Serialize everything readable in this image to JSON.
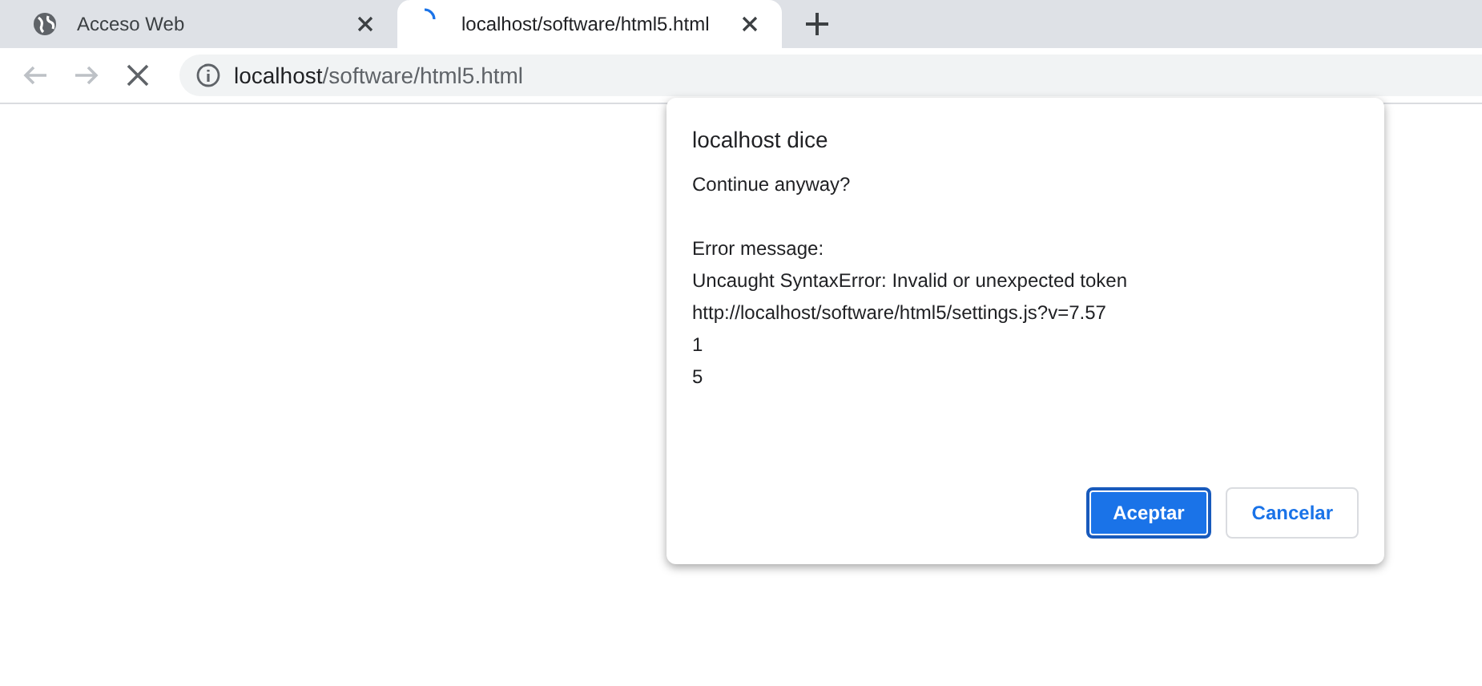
{
  "tabs": [
    {
      "title": "Acceso Web",
      "selected": false,
      "loading": false
    },
    {
      "title": "localhost/software/html5.html",
      "selected": true,
      "loading": true
    }
  ],
  "toolbar": {
    "nav": [
      {
        "kind": "back",
        "disabled": true
      },
      {
        "kind": "forward",
        "disabled": true
      },
      {
        "kind": "stop",
        "disabled": false
      }
    ],
    "url": {
      "host": "localhost",
      "path": "/software/html5.html"
    }
  },
  "dialog": {
    "title": "localhost dice",
    "paragraphs": [
      [
        "Continue anyway?"
      ],
      [
        "Error message:",
        "Uncaught SyntaxError: Invalid or unexpected token",
        "http://localhost/software/html5/settings.js?v=7.57",
        "1",
        "5"
      ]
    ],
    "buttons": [
      {
        "label": "Aceptar",
        "kind": "primary",
        "focused": true
      },
      {
        "label": "Cancelar",
        "kind": "secondary",
        "focused": false
      }
    ]
  }
}
